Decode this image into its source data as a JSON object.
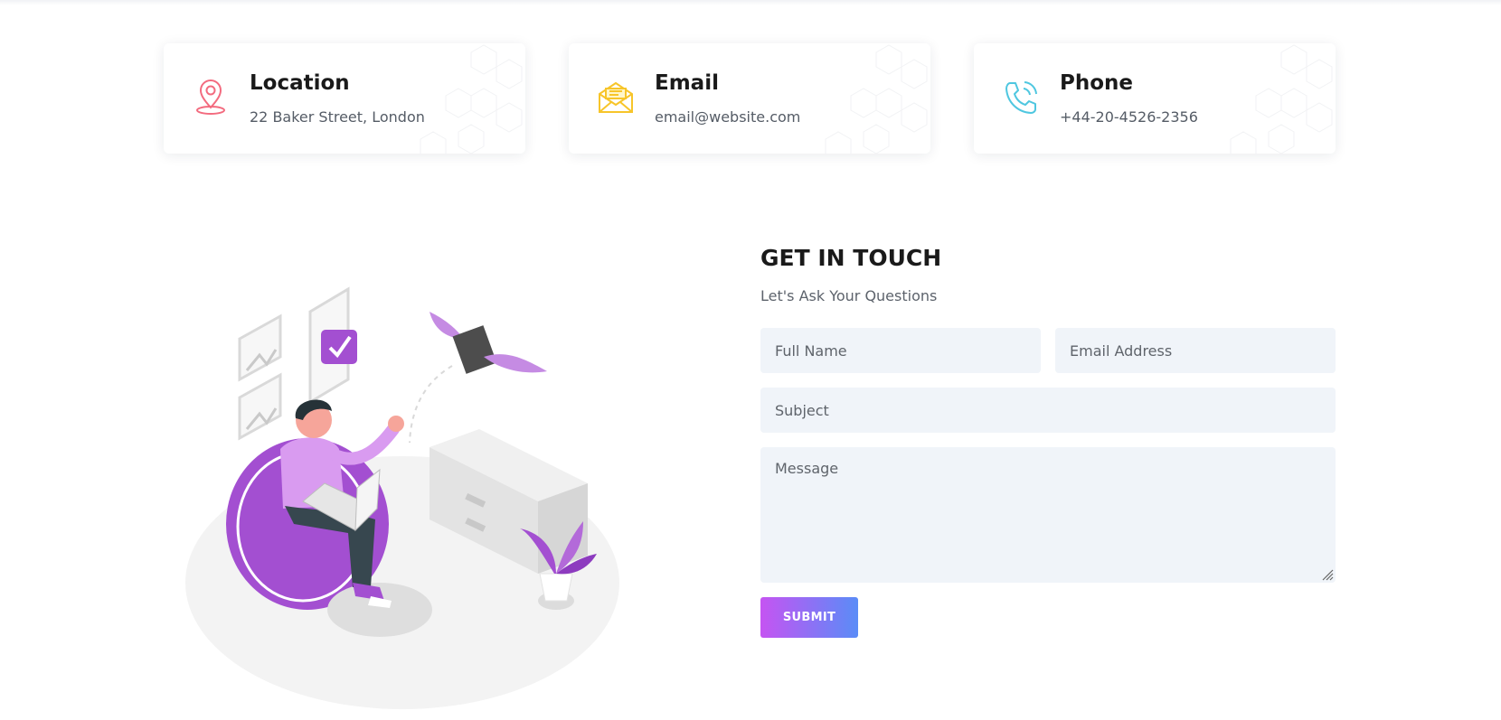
{
  "contact_cards": [
    {
      "title": "Location",
      "text": "22 Baker Street, London",
      "icon": "location-pin-icon",
      "color": "#f36b7f"
    },
    {
      "title": "Email",
      "text": "email@website.com",
      "icon": "envelope-icon",
      "color": "#f7d23a"
    },
    {
      "title": "Phone",
      "text": "+44-20-4526-2356",
      "icon": "phone-icon",
      "color": "#4fc7e0"
    }
  ],
  "form": {
    "heading": "GET IN TOUCH",
    "subheading": "Let's Ask Your Questions",
    "full_name_placeholder": "Full Name",
    "email_placeholder": "Email Address",
    "subject_placeholder": "Subject",
    "message_placeholder": "Message",
    "submit_label": "SUBMIT"
  },
  "colors": {
    "accent_start": "#c554f2",
    "accent_end": "#5a8cf7",
    "field_background": "#f0f4f9",
    "illustration_purple": "#a34fd1"
  }
}
